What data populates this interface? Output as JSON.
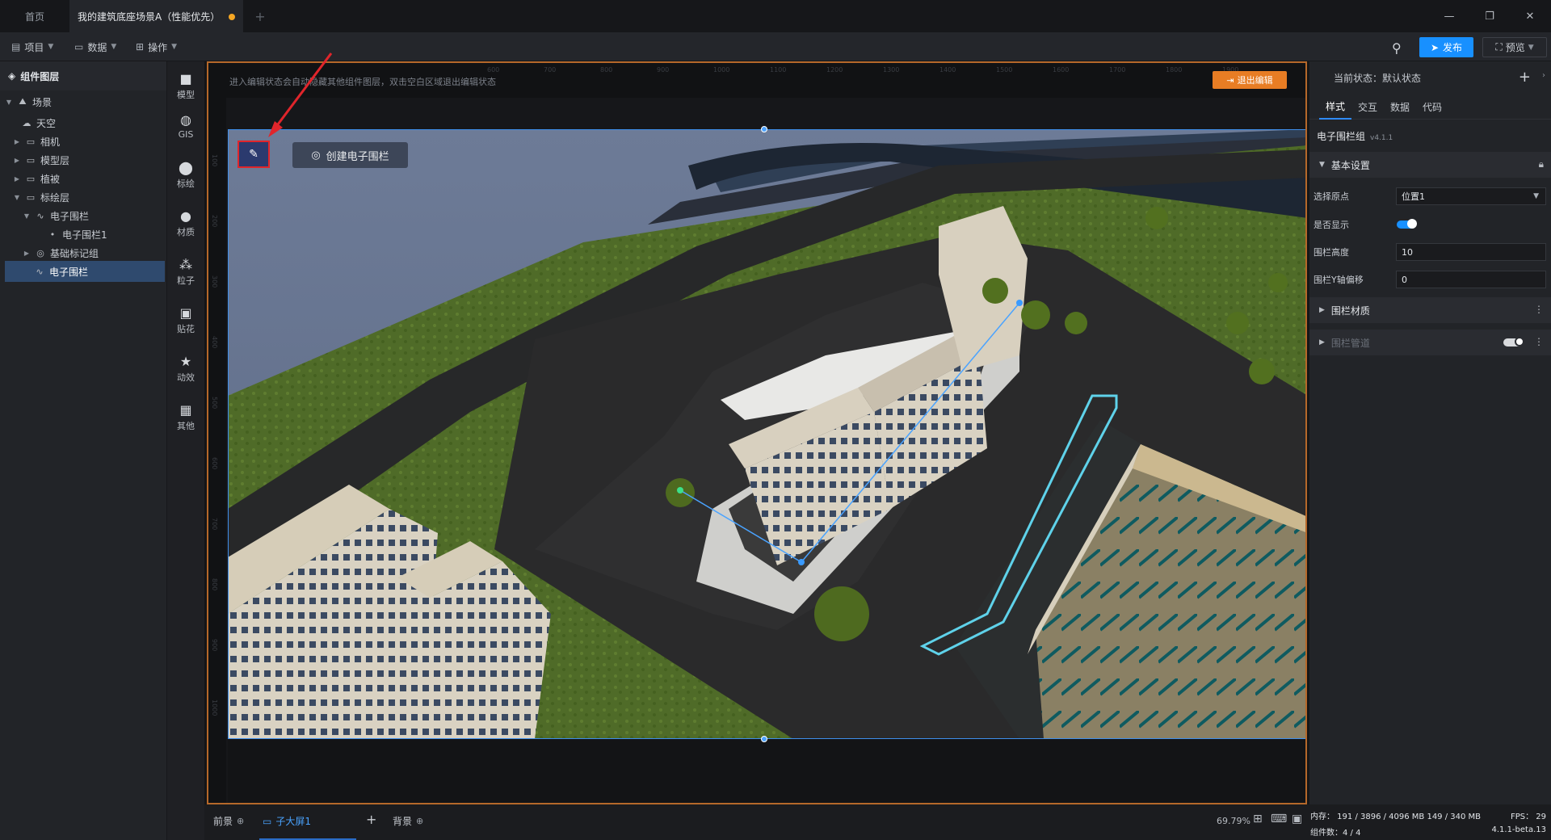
{
  "tabs": {
    "home": "首页",
    "active": "我的建筑底座场景A（性能优先）"
  },
  "toolbar": {
    "menus": [
      {
        "label": "项目"
      },
      {
        "label": "数据"
      },
      {
        "label": "操作"
      }
    ],
    "publish": "发布",
    "preview": "预览"
  },
  "layers": {
    "title": "组件图层",
    "items": [
      {
        "label": "场景"
      },
      {
        "label": "天空"
      },
      {
        "label": "相机"
      },
      {
        "label": "模型层"
      },
      {
        "label": "植被"
      },
      {
        "label": "标绘层"
      },
      {
        "label": "电子围栏"
      },
      {
        "label": "电子围栏1"
      },
      {
        "label": "基础标记组"
      },
      {
        "label": "电子围栏"
      }
    ]
  },
  "iconbar": [
    {
      "label": "模型"
    },
    {
      "label": "GIS"
    },
    {
      "label": "标绘"
    },
    {
      "label": "材质"
    },
    {
      "label": "粒子"
    },
    {
      "label": "贴花"
    },
    {
      "label": "动效"
    },
    {
      "label": "其他"
    }
  ],
  "canvas": {
    "hint": "进入编辑状态会自动隐藏其他组件图层，双击空白区域退出编辑状态",
    "exit_label": "退出编辑",
    "create_fence": "创建电子围栏",
    "ruler_top": [
      "600",
      "700",
      "800",
      "900",
      "1000",
      "1100",
      "1200",
      "1300",
      "1400",
      "1500",
      "1600",
      "1700",
      "1800",
      "1900"
    ],
    "ruler_left": [
      "100",
      "200",
      "300",
      "400",
      "500",
      "600",
      "700",
      "800",
      "900",
      "1000"
    ]
  },
  "bottom": {
    "tab_front": "前景",
    "tab_screen": "子大屏1",
    "tab_back": "背景",
    "zoom": "69.79%"
  },
  "props": {
    "state": "当前状态：默认状态",
    "tabs": [
      "样式",
      "交互",
      "数据",
      "代码"
    ],
    "component_title": "电子围栏组",
    "component_version": "v4.1.1",
    "section_basic": "基本设置",
    "origin_label": "选择原点",
    "origin_value": "位置1",
    "visible_label": "是否显示",
    "height_label": "围栏高度",
    "height_value": "10",
    "yoffset_label": "围栏Y轴偏移",
    "yoffset_value": "0",
    "section_material": "围栏材质",
    "section_pipe": "围栏管道"
  },
  "status": {
    "memory": "内存： 191 / 3896 / 4096 MB  149 / 340 MB",
    "components": "组件数：4 / 4",
    "fps": "FPS： 29",
    "version": "4.1.1-beta.13"
  },
  "colors": {
    "accent": "#1890ff",
    "exit": "#e87d24",
    "unsaved_dot": "#f5a623",
    "highlight": "#e0252b"
  }
}
